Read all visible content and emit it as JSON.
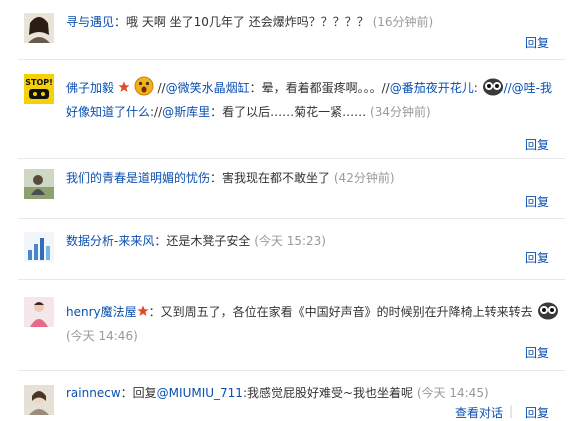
{
  "comments": [
    {
      "name": "寻与遇见",
      "sep": "：",
      "text": "哦 天啊 坐了10几年了 还会爆炸吗？？？？？",
      "time": "(16分钟前)",
      "reply": "回复"
    },
    {
      "name": "佛子加毅",
      "part1": "//",
      "at1": "@微笑水晶烟缸",
      "part2": "：晕，看着都蛋疼啊。。。//",
      "at2": "@番茄夜开花儿",
      "part3": ":",
      "at3": "//@哇-我好像知道了什么",
      "part4": "://",
      "at4": "@斯库里",
      "part5": "：看了以后……菊花一紧……",
      "time": "(34分钟前)",
      "reply": "回复",
      "avatar_label": "STOP!"
    },
    {
      "name": "我们的青春是道明媚的忧伤",
      "sep": "：",
      "text": "害我现在都不敢坐了",
      "time": "(42分钟前)",
      "reply": "回复"
    },
    {
      "name": "数据分析-来来风",
      "sep": "：",
      "text": "还是木凳子安全",
      "time": "(今天 15:23)",
      "reply": "回复"
    },
    {
      "name": "henry魔法屋",
      "sep": "：",
      "text": "又到周五了，各位在家看《中国好声音》的时候别在升降椅上转来转去",
      "time": "(今天 14:46)",
      "reply": "回复"
    },
    {
      "name": "rainnecw",
      "sep": "：",
      "reply_prefix": "回复",
      "at": "@MIUMIU_711",
      "text": ":我感觉屁股好难受~我也坐着呢",
      "time": "(今天 14:45)",
      "view_dialog": "查看对话",
      "reply": "回复"
    }
  ],
  "colors": {
    "link": "#0a4fb0",
    "time": "#999999",
    "badge": "#e34a2a"
  }
}
